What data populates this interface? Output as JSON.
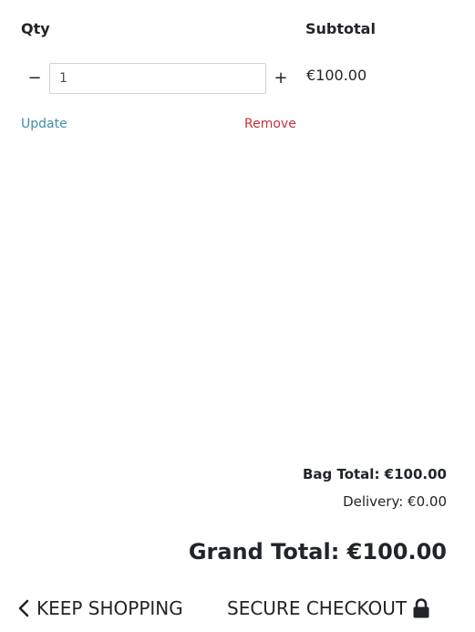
{
  "columns": {
    "qty": "Qty",
    "subtotal": "Subtotal"
  },
  "item": {
    "quantity": "1",
    "decrement_symbol": "−",
    "increment_symbol": "+",
    "subtotal": "€100.00",
    "update_label": "Update",
    "remove_label": "Remove"
  },
  "totals": {
    "bag_total": "Bag Total: €100.00",
    "delivery": "Delivery: €0.00",
    "grand_total": "Grand Total: €100.00"
  },
  "footer": {
    "keep_shopping": "KEEP SHOPPING",
    "keep_shopping_icon": "chevron-left-icon",
    "secure_checkout": "SECURE CHECKOUT",
    "secure_checkout_icon": "lock-icon"
  },
  "colors": {
    "update_link": "#3d8ea6",
    "remove_link": "#c9303c",
    "text": "#212529"
  }
}
